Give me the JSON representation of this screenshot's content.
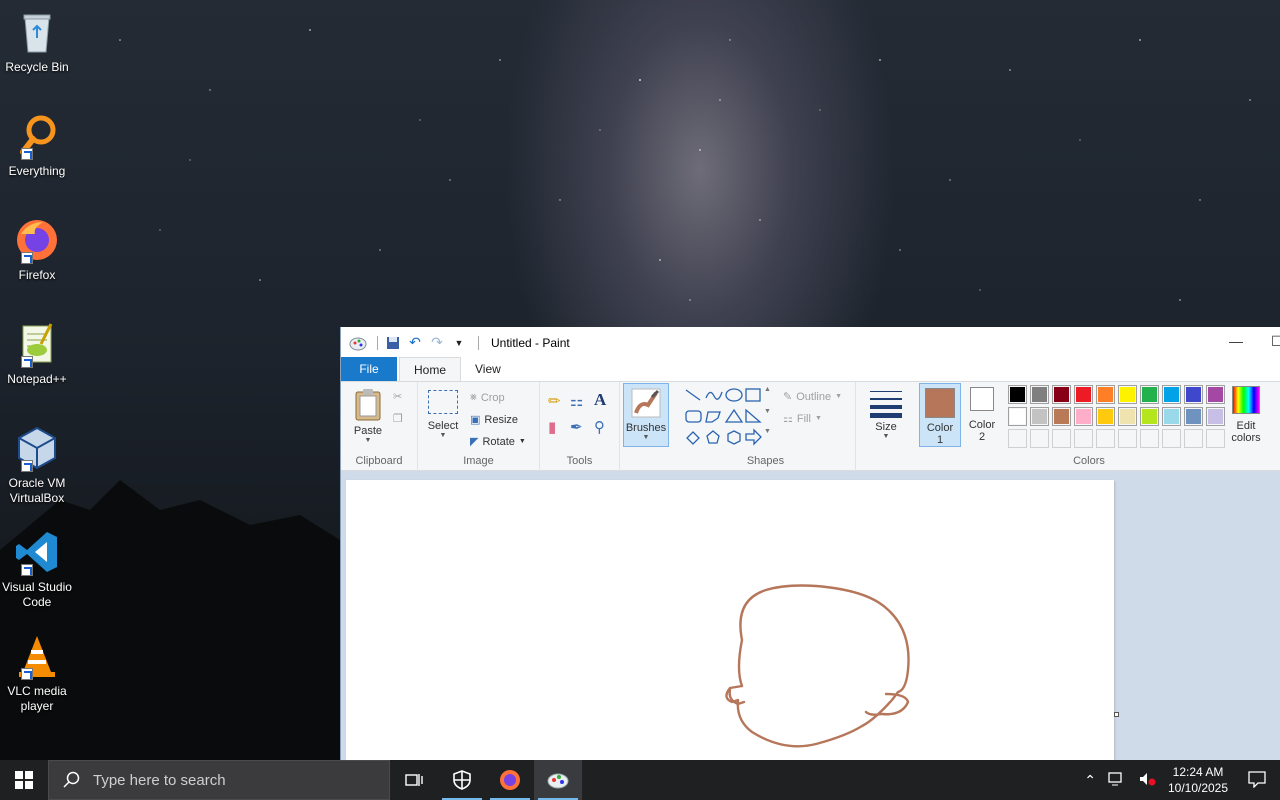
{
  "desktop": {
    "icons": [
      {
        "label": "Recycle Bin",
        "icon": "recycle-bin-icon"
      },
      {
        "label": "Everything",
        "icon": "everything-search-icon"
      },
      {
        "label": "Firefox",
        "icon": "firefox-icon"
      },
      {
        "label": "Notepad++",
        "icon": "notepad-plus-plus-icon"
      },
      {
        "label": "Oracle VM VirtualBox",
        "icon": "virtualbox-icon"
      },
      {
        "label": "Visual Studio Code",
        "icon": "vscode-icon"
      },
      {
        "label": "VLC media player",
        "icon": "vlc-icon"
      }
    ]
  },
  "paint": {
    "title": "Untitled - Paint",
    "tabs": {
      "file": "File",
      "home": "Home",
      "view": "View"
    },
    "groups": {
      "clipboard": "Clipboard",
      "image": "Image",
      "tools": "Tools",
      "shapes": "Shapes",
      "colors": "Colors"
    },
    "buttons": {
      "paste": "Paste",
      "select": "Select",
      "crop": "Crop",
      "resize": "Resize",
      "rotate": "Rotate",
      "brushes": "Brushes",
      "outline": "Outline",
      "fill": "Fill",
      "size": "Size",
      "color1": "Color",
      "color1_num": "1",
      "color2": "Color",
      "color2_num": "2",
      "edit_colors_1": "Edit",
      "edit_colors_2": "colors"
    },
    "color1_value": "#b5765a",
    "color2_value": "#ffffff",
    "palette_row1": [
      "#000000",
      "#7f7f7f",
      "#880015",
      "#ed1c24",
      "#ff7f27",
      "#fff200",
      "#22b14c",
      "#00a2e8",
      "#3f48cc",
      "#a349a4"
    ],
    "palette_row2": [
      "#ffffff",
      "#c3c3c3",
      "#b97a57",
      "#ffaec9",
      "#ffc90e",
      "#efe4b0",
      "#b5e61d",
      "#99d9ea",
      "#7092be",
      "#c8bfe7"
    ],
    "drawing_color": "#b5765a"
  },
  "taskbar": {
    "search_placeholder": "Type here to search",
    "time": "12:24 AM",
    "date": "10/10/2025"
  }
}
